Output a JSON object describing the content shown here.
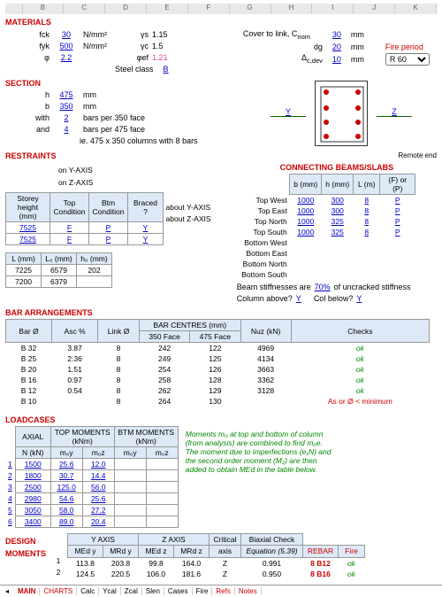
{
  "colheaders": [
    "B",
    "C",
    "D",
    "E",
    "F",
    "G",
    "H",
    "I",
    "J",
    "K"
  ],
  "materials": {
    "title": "MATERIALS",
    "fck_lbl": "fck",
    "fck": "30",
    "fck_u": "N/mm²",
    "fyk_lbl": "fyk",
    "fyk": "500",
    "fyk_u": "N/mm²",
    "phi_lbl": "φ",
    "phi": "2.2",
    "gs_lbl": "γs",
    "gs": "1.15",
    "gc_lbl": "γc",
    "gc": "1.5",
    "phief_lbl": "φef",
    "phief": "1.21",
    "steel_lbl": "Steel class",
    "steel": "B",
    "cover_lbl": "Cover to link, C",
    "cover_sub": "nom",
    "cover": "30",
    "cover_u": "mm",
    "dg_lbl": "dg",
    "dg": "20",
    "dg_u": "mm",
    "dcdev_lbl": "Δ",
    "dcdev_sub": "c,dev",
    "dcdev": "10",
    "dcdev_u": "mm",
    "fire_lbl": "Fire period",
    "fire_opt": "R 60"
  },
  "section": {
    "title": "SECTION",
    "h_lbl": "h",
    "h": "475",
    "h_u": "mm",
    "b_lbl": "b",
    "b": "350",
    "b_u": "mm",
    "with_lbl": "with",
    "with": "2",
    "with_t": "bars per 350 face",
    "and_lbl": "and",
    "and": "4",
    "and_t": "bars per 475 face",
    "ie": "ie. 475 x 350 columns with 8 bars",
    "y": "Y",
    "z": "Z"
  },
  "restraints": {
    "title": "RESTRAINTS",
    "hdr": [
      "Storey height (mm)",
      "Top Condition",
      "Btm Condition",
      "Braced ?"
    ],
    "rows": [
      {
        "axis": "on Y-AXIS",
        "h": "7525",
        "t": "F",
        "b": "P",
        "br": "Y"
      },
      {
        "axis": "on Z-AXIS",
        "h": "7525",
        "t": "F",
        "b": "P",
        "br": "Y"
      }
    ],
    "lhdr": [
      "L (mm)",
      "L₀ (mm)",
      "h₀ (mm)"
    ],
    "lrows": [
      {
        "axis": "about Y-AXIS",
        "L": "7225",
        "L0": "6579",
        "h0": "202"
      },
      {
        "axis": "about Z-AXIS",
        "L": "7200",
        "L0": "6379",
        "h0": ""
      }
    ]
  },
  "beams": {
    "title": "CONNECTING BEAMS/SLABS",
    "remote": "Remote end",
    "hdr": [
      "b (mm)",
      "h (mm)",
      "L (m)",
      "(F) or (P)"
    ],
    "rows": [
      {
        "lbl": "Top West",
        "b": "1000",
        "h": "300",
        "L": "8",
        "e": "P"
      },
      {
        "lbl": "Top East",
        "b": "1000",
        "h": "300",
        "L": "8",
        "e": "P"
      },
      {
        "lbl": "Top North",
        "b": "1000",
        "h": "325",
        "L": "8",
        "e": "P"
      },
      {
        "lbl": "Top South",
        "b": "1000",
        "h": "325",
        "L": "8",
        "e": "P"
      },
      {
        "lbl": "Bottom West"
      },
      {
        "lbl": "Bottom East"
      },
      {
        "lbl": "Bottom North"
      },
      {
        "lbl": "Bottom South"
      }
    ],
    "stiff_lbl": "Beam stiffnesses are",
    "stiff": "70%",
    "stiff_t": "of uncracked stiffness",
    "above_lbl": "Column above?",
    "above": "Y",
    "below_lbl": "Col below?",
    "below": "Y"
  },
  "bars": {
    "title": "BAR ARRANGEMENTS",
    "centres": "BAR CENTRES (mm)",
    "hdr": [
      "Bar Ø",
      "Asc %",
      "Link Ø",
      "350 Face",
      "475 Face",
      "Nuz (kN)",
      "Checks"
    ],
    "rows": [
      {
        "d": "B 32",
        "a": "3.87",
        "l": "8",
        "f1": "242",
        "f2": "122",
        "n": "4969",
        "c": "ok",
        "ok": true
      },
      {
        "d": "B 25",
        "a": "2.36",
        "l": "8",
        "f1": "249",
        "f2": "125",
        "n": "4134",
        "c": "ok",
        "ok": true
      },
      {
        "d": "B 20",
        "a": "1.51",
        "l": "8",
        "f1": "254",
        "f2": "126",
        "n": "3663",
        "c": "ok",
        "ok": true
      },
      {
        "d": "B 16",
        "a": "0.97",
        "l": "8",
        "f1": "258",
        "f2": "128",
        "n": "3362",
        "c": "ok",
        "ok": true
      },
      {
        "d": "B 12",
        "a": "0.54",
        "l": "8",
        "f1": "262",
        "f2": "129",
        "n": "3128",
        "c": "ok",
        "ok": true
      },
      {
        "d": "B 10",
        "a": "",
        "l": "8",
        "f1": "264",
        "f2": "130",
        "n": "",
        "c": "As or Ø < minimum",
        "ok": false
      }
    ]
  },
  "loadcases": {
    "title": "LOADCASES",
    "grphdr": [
      "AXIAL",
      "TOP MOMENTS (kNm)",
      "BTM MOMENTS (kNm)"
    ],
    "hdr": [
      "N (kN)",
      "m₀y",
      "m₀z",
      "m₀y",
      "m₀z"
    ],
    "rows": [
      {
        "n": "1",
        "N": "1500",
        "t1": "25.6",
        "t2": "12.0"
      },
      {
        "n": "2",
        "N": "1800",
        "t1": "30.7",
        "t2": "14.4"
      },
      {
        "n": "3",
        "N": "2500",
        "t1": "125.0",
        "t2": "56.0"
      },
      {
        "n": "4",
        "N": "2980",
        "t1": "54.6",
        "t2": "25.6"
      },
      {
        "n": "5",
        "N": "3050",
        "t1": "58.0",
        "t2": "27.2"
      },
      {
        "n": "6",
        "N": "3400",
        "t1": "89.0",
        "t2": "20.4"
      }
    ],
    "notes": [
      "Moments m₀ at top and bottom of column",
      "(from analysis) are combined to find m₀e.",
      "The moment due to imperfections (e₁N) and",
      "the second order moment (M₂) are then",
      "added to obtain MEd in the table below."
    ]
  },
  "design": {
    "title": "DESIGN",
    "title2": "MOMENTS",
    "grphdr": [
      "Y AXIS",
      "Z AXIS",
      "Critical",
      "Biaxial Check"
    ],
    "hdr": [
      "MEd y",
      "MRd y",
      "MEd z",
      "MRd z",
      "axis",
      "Equation (5.39)",
      "REBAR",
      "Fire"
    ],
    "rows": [
      {
        "n": "1",
        "M1": "113.8",
        "M2": "203.8",
        "M3": "99.8",
        "M4": "164.0",
        "ax": "Z",
        "eq": "0.991",
        "rb": "8 B12",
        "f": "ok"
      },
      {
        "n": "2",
        "M1": "124.5",
        "M2": "220.5",
        "M3": "106.0",
        "M4": "181.6",
        "ax": "Z",
        "eq": "0.950",
        "rb": "8 B16",
        "f": "ok"
      }
    ]
  },
  "tabs": [
    {
      "t": "MAIN",
      "cls": "active red"
    },
    {
      "t": "CHARTS",
      "cls": "red"
    },
    {
      "t": "Calc"
    },
    {
      "t": "Ycal"
    },
    {
      "t": "Zcal"
    },
    {
      "t": "Slen"
    },
    {
      "t": "Cases"
    },
    {
      "t": "Fire"
    },
    {
      "t": "Refs",
      "cls": "red"
    },
    {
      "t": "Notes",
      "cls": "red"
    }
  ]
}
